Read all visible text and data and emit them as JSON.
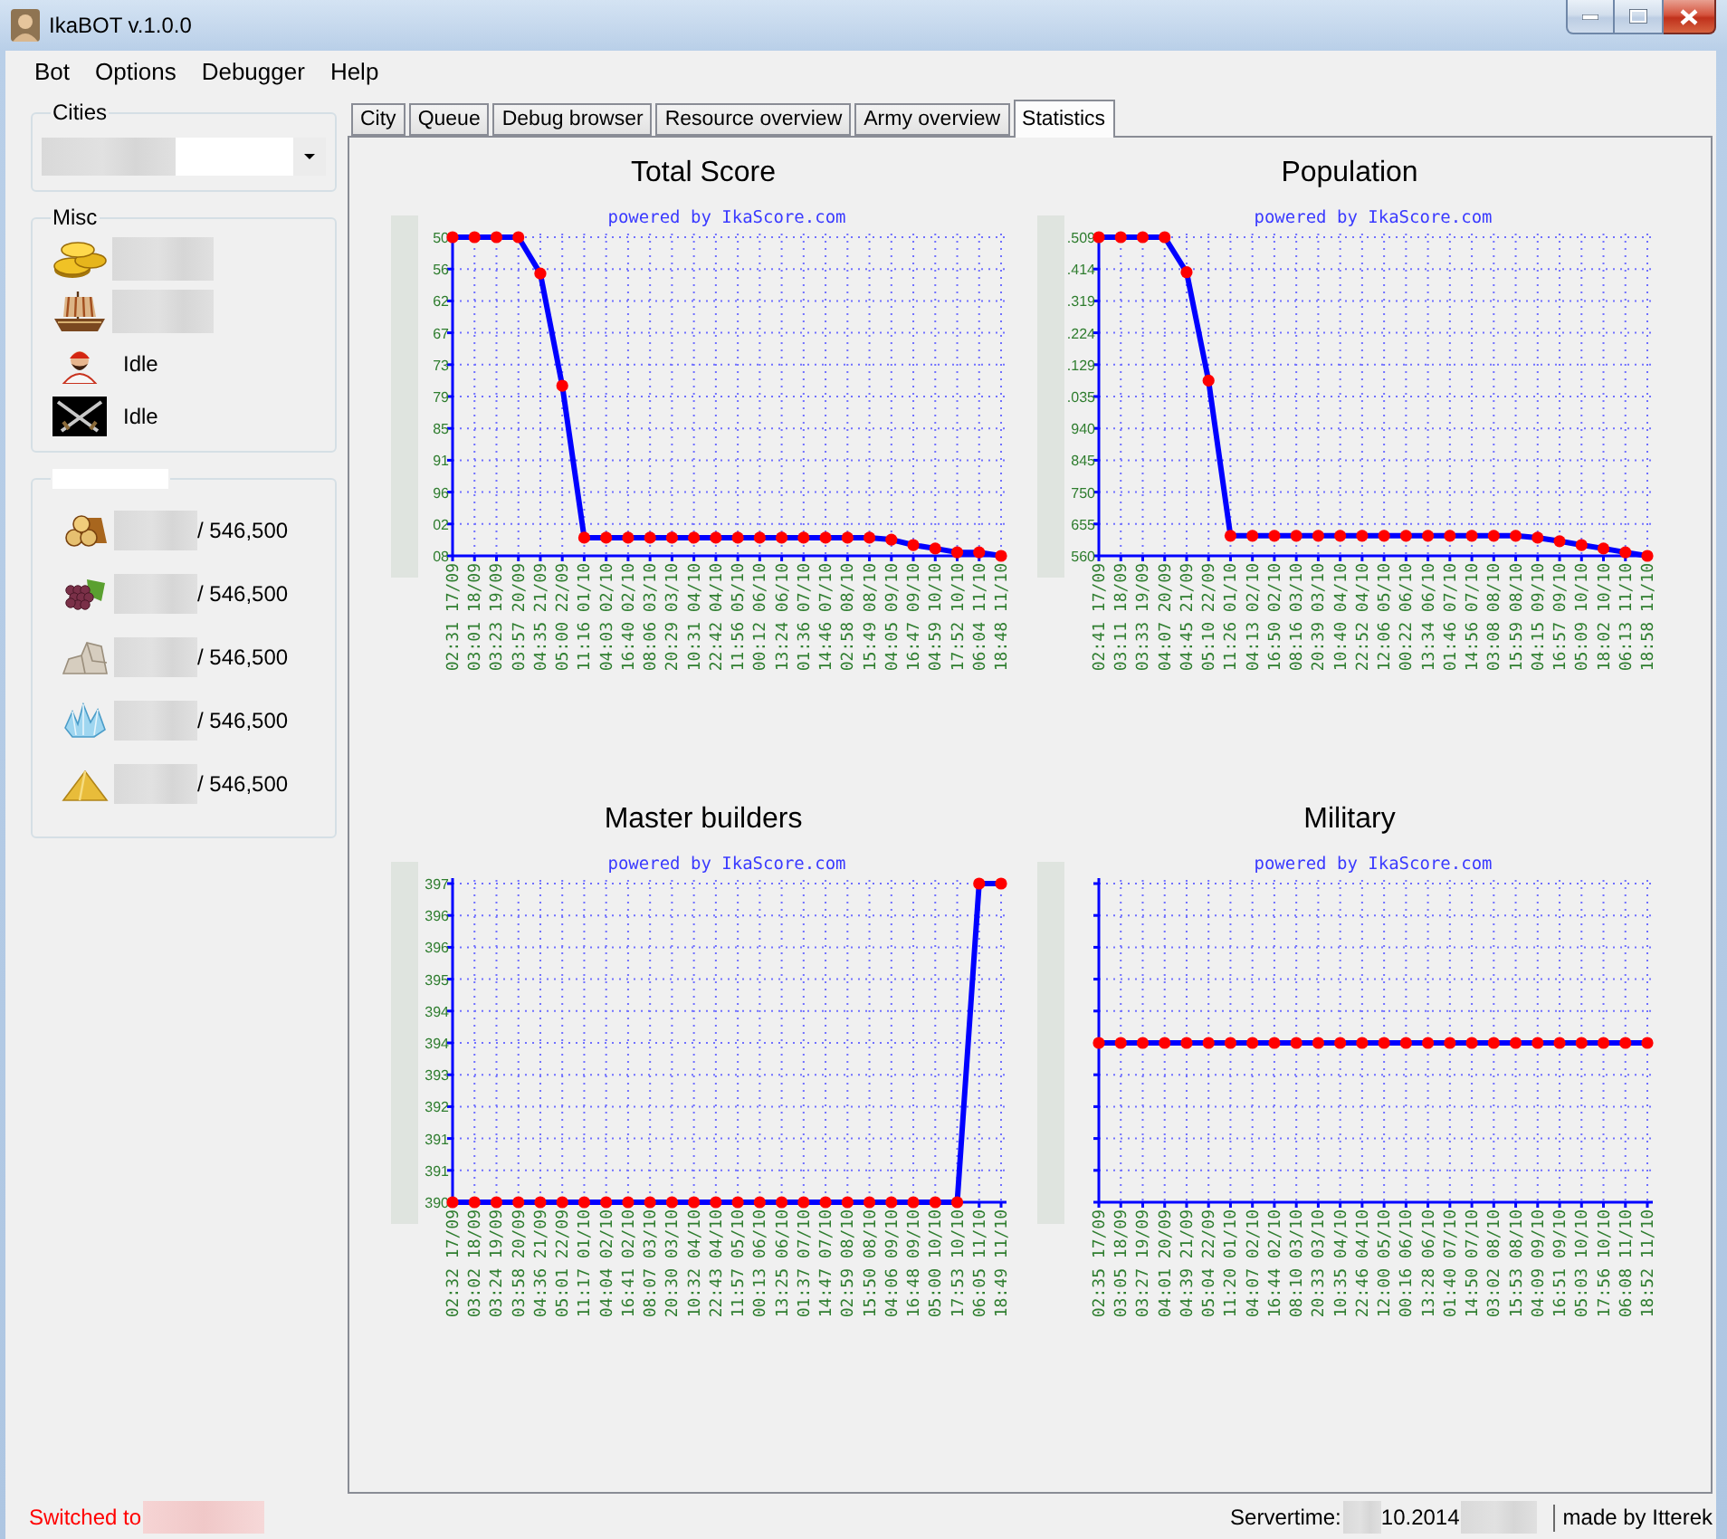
{
  "window": {
    "title": "IkaBOT v.1.0.0"
  },
  "menu": [
    "Bot",
    "Options",
    "Debugger",
    "Help"
  ],
  "sidebar": {
    "cities": {
      "label": "Cities"
    },
    "misc": {
      "label": "Misc",
      "rows": [
        {
          "kind": "blurred"
        },
        {
          "kind": "blurred"
        },
        {
          "kind": "status",
          "status": "Idle"
        },
        {
          "kind": "status",
          "status": "Idle"
        }
      ]
    },
    "resources": [
      {
        "capacity": "/ 546,500"
      },
      {
        "capacity": "/ 546,500"
      },
      {
        "capacity": "/ 546,500"
      },
      {
        "capacity": "/ 546,500"
      },
      {
        "capacity": "/ 546,500"
      }
    ]
  },
  "tabs": [
    {
      "label": "City",
      "selected": false
    },
    {
      "label": "Queue",
      "selected": false
    },
    {
      "label": "Debug browser",
      "selected": false
    },
    {
      "label": "Resource overview",
      "selected": false
    },
    {
      "label": "Army overview",
      "selected": false
    },
    {
      "label": "Statistics",
      "selected": true
    }
  ],
  "charts": [
    {
      "title": "Total Score",
      "credit": "powered by IkaScore.com",
      "y_tick_labels": [
        "50",
        "56",
        "62",
        "67",
        "73",
        "79",
        "85",
        "91",
        "96",
        "02",
        "08"
      ],
      "x_labels": [
        "02:31 17/09",
        "03:01 18/09",
        "03:23 19/09",
        "03:57 20/09",
        "04:35 21/09",
        "05:00 22/09",
        "11:16 01/10",
        "04:03 02/10",
        "16:40 02/10",
        "08:06 03/10",
        "20:29 03/10",
        "10:31 04/10",
        "22:42 04/10",
        "11:56 05/10",
        "00:12 06/10",
        "13:24 06/10",
        "01:36 07/10",
        "14:46 07/10",
        "02:58 08/10",
        "15:49 08/10",
        "04:05 09/10",
        "16:47 09/10",
        "04:59 10/10",
        "17:52 10/10",
        "06:04 11/10",
        "18:48 11/10"
      ]
    },
    {
      "title": "Population",
      "credit": "powered by IkaScore.com",
      "y_tick_labels": [
        ".509",
        ".414",
        ".319",
        ".224",
        ".129",
        ".035",
        "940",
        "845",
        "750",
        "655",
        "560"
      ],
      "x_labels": [
        "02:41 17/09",
        "03:11 18/09",
        "03:33 19/09",
        "04:07 20/09",
        "04:45 21/09",
        "05:10 22/09",
        "11:26 01/10",
        "04:13 02/10",
        "16:50 02/10",
        "08:16 03/10",
        "20:39 03/10",
        "10:40 04/10",
        "22:52 04/10",
        "12:06 05/10",
        "00:22 06/10",
        "13:34 06/10",
        "01:46 07/10",
        "14:56 07/10",
        "03:08 08/10",
        "15:59 08/10",
        "04:15 09/10",
        "16:57 09/10",
        "05:09 10/10",
        "18:02 10/10",
        "06:13 11/10",
        "18:58 11/10"
      ]
    },
    {
      "title": "Master builders",
      "credit": "powered by IkaScore.com",
      "y_tick_labels": [
        "397",
        "396",
        "396",
        "395",
        "394",
        "394",
        "393",
        "392",
        "391",
        "391",
        "390"
      ],
      "x_labels": [
        "02:32 17/09",
        "03:02 18/09",
        "03:24 19/09",
        "03:58 20/09",
        "04:36 21/09",
        "05:01 22/09",
        "11:17 01/10",
        "04:04 02/10",
        "16:41 02/10",
        "08:07 03/10",
        "20:30 03/10",
        "10:32 04/10",
        "22:43 04/10",
        "11:57 05/10",
        "00:13 06/10",
        "13:25 06/10",
        "01:37 07/10",
        "14:47 07/10",
        "02:59 08/10",
        "15:50 08/10",
        "04:06 09/10",
        "16:48 09/10",
        "05:00 10/10",
        "17:53 10/10",
        "06:05 11/10",
        "18:49 11/10"
      ]
    },
    {
      "title": "Military",
      "credit": "powered by IkaScore.com",
      "x_labels": [
        "02:35 17/09",
        "03:05 18/09",
        "03:27 19/09",
        "04:01 20/09",
        "04:39 21/09",
        "05:04 22/09",
        "11:20 01/10",
        "04:07 02/10",
        "16:44 02/10",
        "08:10 03/10",
        "20:33 03/10",
        "10:35 04/10",
        "22:46 04/10",
        "12:00 05/10",
        "00:16 06/10",
        "13:28 06/10",
        "01:40 07/10",
        "14:50 07/10",
        "03:02 08/10",
        "15:53 08/10",
        "04:09 09/10",
        "16:51 09/10",
        "05:03 10/10",
        "17:56 10/10",
        "06:08 11/10",
        "18:52 11/10"
      ]
    }
  ],
  "status_bar": {
    "message": "Switched to",
    "servertime_label": "Servertime:",
    "servertime_value": "10.2014",
    "credit": "made by Itterek"
  }
}
